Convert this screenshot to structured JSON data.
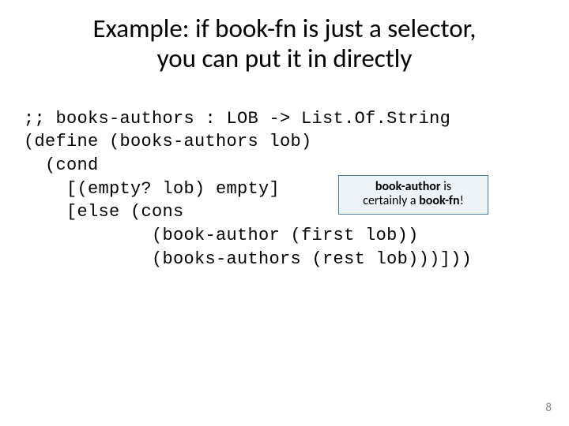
{
  "title_line1": "Example: if book-fn is just a selector,",
  "title_line2": "you can put it in directly",
  "code": {
    "l1": ";; books-authors : LOB -> List.Of.String",
    "l2": "(define (books-authors lob)",
    "l3": "  (cond",
    "l4": "    [(empty? lob) empty]",
    "l5": "    [else (cons",
    "l6": "            (book-author (first lob))",
    "l7": "            (books-authors (rest lob)))]))"
  },
  "callout": {
    "strong1": "book-author",
    "mid": " is",
    "line2a": "certainly a ",
    "strong2": "book-fn",
    "tail": "!"
  },
  "page_number": "8"
}
